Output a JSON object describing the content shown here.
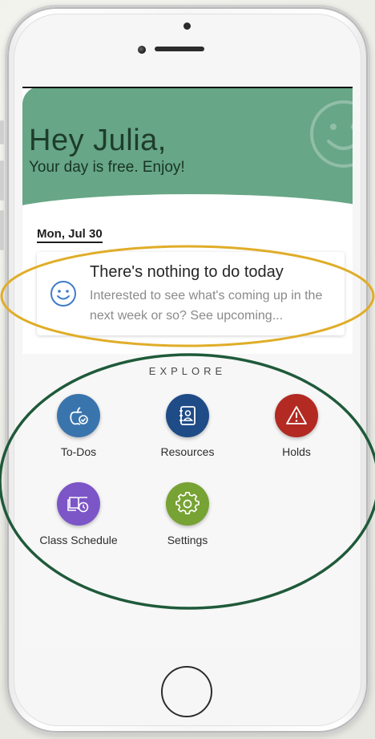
{
  "header": {
    "greeting": "Hey Julia,",
    "subtitle": "Your day is free. Enjoy!",
    "accent_color": "#67a686"
  },
  "agenda": {
    "date": "Mon, Jul 30",
    "card_title": "There's nothing to do today",
    "card_text": "Interested to see what's coming up in the next week or so? See upcoming..."
  },
  "explore": {
    "title": "EXPLORE",
    "tiles": [
      {
        "label": "To-Dos",
        "icon": "apple-check-icon",
        "color": "#3a74ad"
      },
      {
        "label": "Resources",
        "icon": "contact-book-icon",
        "color": "#1f4b87"
      },
      {
        "label": "Holds",
        "icon": "warning-icon",
        "color": "#b22a22"
      },
      {
        "label": "Class Schedule",
        "icon": "book-clock-icon",
        "color": "#7c55c7"
      },
      {
        "label": "Settings",
        "icon": "gear-icon",
        "color": "#77a234"
      }
    ]
  },
  "annotations": {
    "card_highlight_color": "#e0ad28",
    "explore_highlight_color": "#1f5a3a"
  }
}
